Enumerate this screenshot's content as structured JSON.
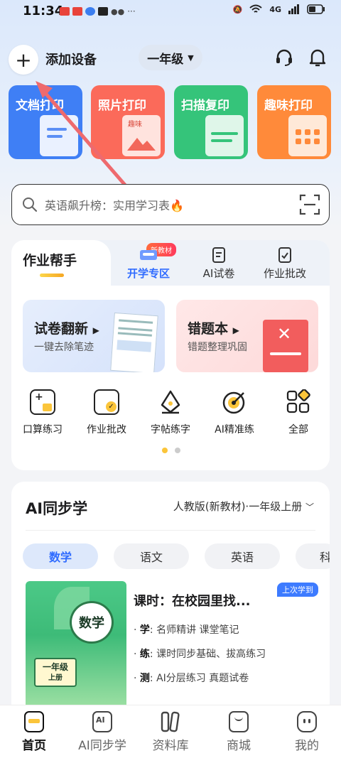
{
  "status_bar": {
    "time": "11:34",
    "network": "4G"
  },
  "header": {
    "add_device_label": "添加设备",
    "grade": "一年级"
  },
  "print_cards": [
    {
      "label": "文档打印",
      "color": "#3f7ff5"
    },
    {
      "label": "照片打印",
      "color": "#fb6a5a"
    },
    {
      "label": "扫描复印",
      "color": "#35c47a"
    },
    {
      "label": "趣味打印",
      "color": "#ff8a3a"
    }
  ],
  "photo_card_tag": "趣味",
  "search": {
    "placeholder": "英语飙升榜：实用学习表🔥"
  },
  "homework": {
    "title": "作业帮手",
    "new_badge": "新教材",
    "tabs": [
      "开学专区",
      "AI试卷",
      "作业批改"
    ],
    "cards": [
      {
        "title": "试卷翻新",
        "subtitle": "一键去除笔迹"
      },
      {
        "title": "错题本",
        "subtitle": "错题整理巩固"
      }
    ],
    "tools": [
      "口算练习",
      "作业批改",
      "字帖练字",
      "AI精准练",
      "全部"
    ]
  },
  "ai_sync": {
    "title": "AI同步学",
    "edition": "人教版(新教材)·一年级上册",
    "subjects": [
      "数学",
      "语文",
      "英语",
      "科"
    ],
    "book": {
      "subject": "数学",
      "grade": "一年级",
      "volume": "上册"
    },
    "last_badge": "上次学到",
    "lesson_title": "课时：在校园里找...",
    "lines": [
      {
        "key": "学",
        "text": "名师精讲 课堂笔记"
      },
      {
        "key": "练",
        "text": "课时同步基础、拔高练习"
      },
      {
        "key": "测",
        "text": "AI分层练习 真题试卷"
      }
    ]
  },
  "bottom_nav": [
    "首页",
    "AI同步学",
    "资料库",
    "商城",
    "我的"
  ],
  "accent": "#2f6bff"
}
